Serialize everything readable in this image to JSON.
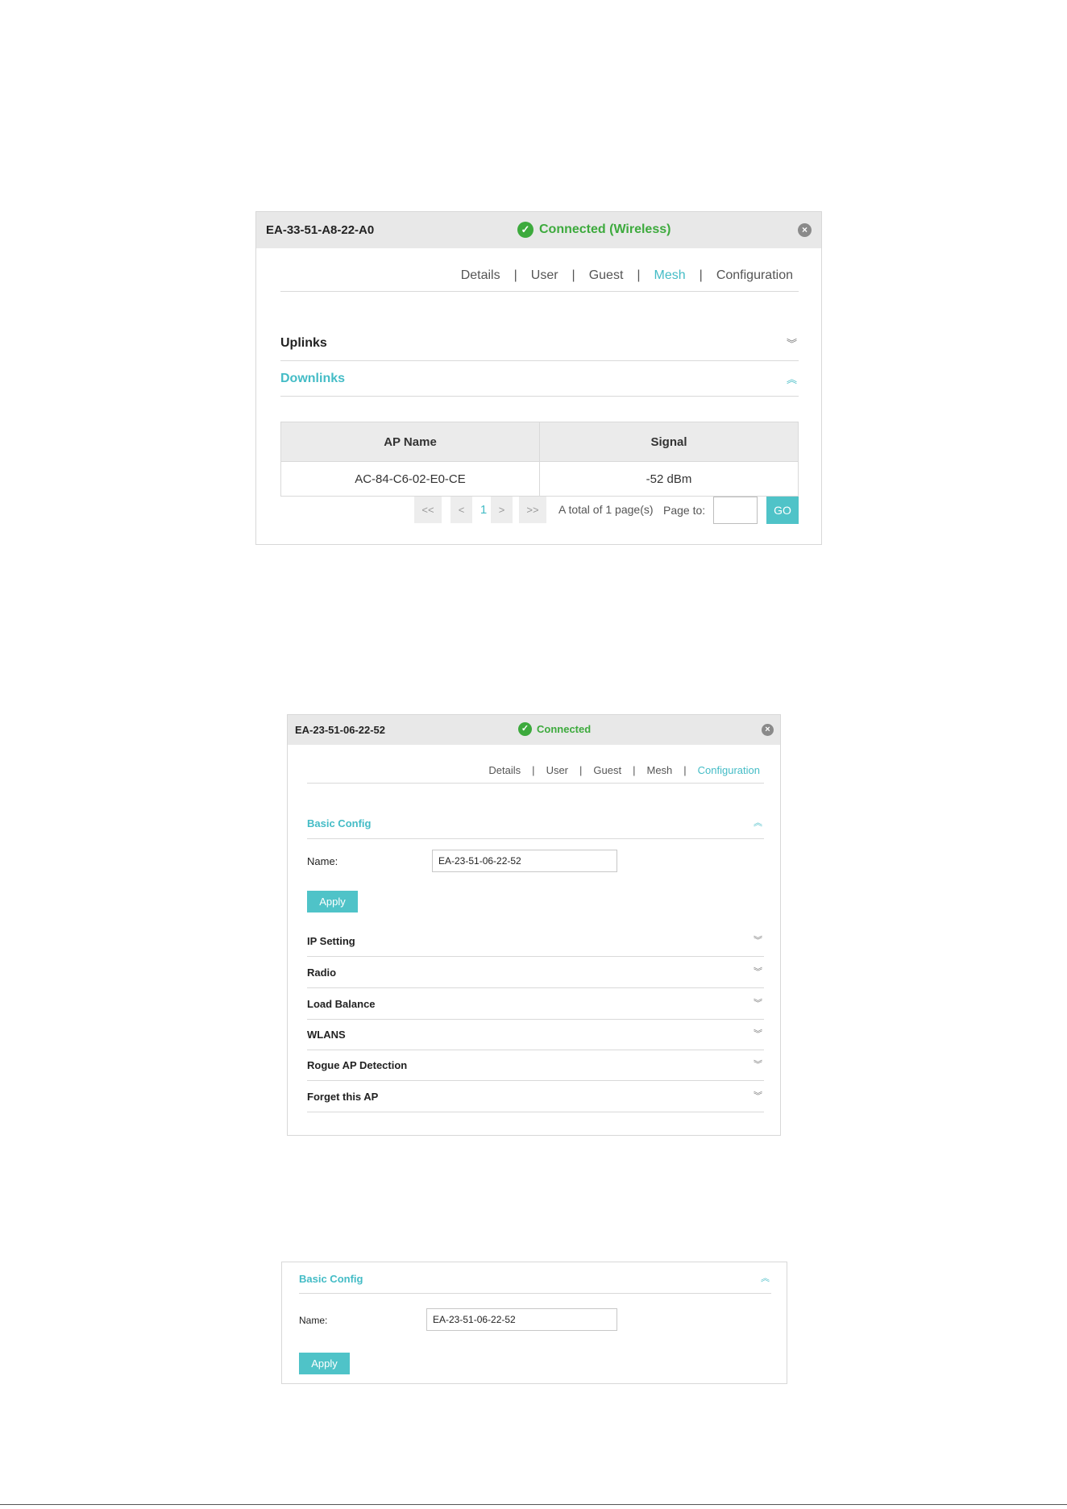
{
  "panel1": {
    "mac": "EA-33-51-A8-22-A0",
    "status": "Connected (Wireless)",
    "tabs": [
      "Details",
      "User",
      "Guest",
      "Mesh",
      "Configuration"
    ],
    "active_tab": "Mesh",
    "sections": {
      "uplinks": "Uplinks",
      "downlinks": "Downlinks"
    },
    "table": {
      "headers": [
        "AP Name",
        "Signal"
      ],
      "rows": [
        [
          "AC-84-C6-02-E0-CE",
          "-52 dBm"
        ]
      ]
    },
    "pagination": {
      "first": "<<",
      "prev": "<",
      "current": "1",
      "next": ">",
      "last": ">>",
      "total_text": "A total of 1 page(s)",
      "page_to_label": "Page to:",
      "go_label": "GO"
    }
  },
  "panel2": {
    "mac": "EA-23-51-06-22-52",
    "status": "Connected",
    "tabs": [
      "Details",
      "User",
      "Guest",
      "Mesh",
      "Configuration"
    ],
    "active_tab": "Configuration",
    "basic_config": {
      "title": "Basic Config",
      "name_label": "Name:",
      "name_value": "EA-23-51-06-22-52",
      "apply_label": "Apply"
    },
    "sections": [
      "IP Setting",
      "Radio",
      "Load Balance",
      "WLANS",
      "Rogue AP Detection",
      "Forget this AP"
    ]
  },
  "panel3": {
    "title": "Basic Config",
    "name_label": "Name:",
    "name_value": "EA-23-51-06-22-52",
    "apply_label": "Apply"
  },
  "icons": {
    "check": "check-circle-icon",
    "close": "close-circle-icon",
    "expand": "double-chevron-down-icon",
    "collapse": "double-chevron-up-icon"
  },
  "colors": {
    "accent": "#44bcc6",
    "connected": "#3daa3d",
    "header_bg": "#e8e8e8"
  }
}
